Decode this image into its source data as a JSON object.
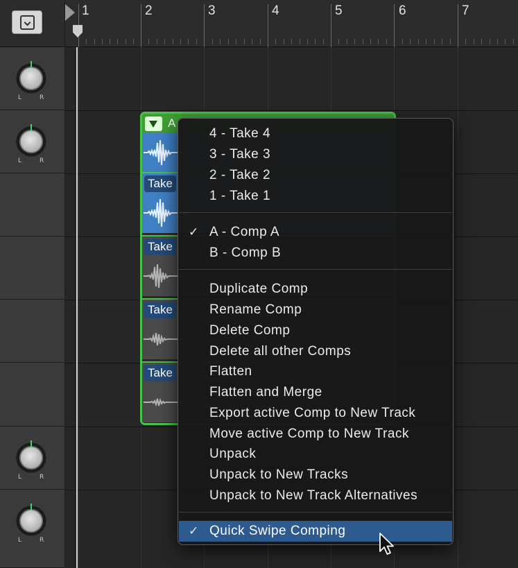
{
  "ruler": {
    "bars": [
      "1",
      "2",
      "3",
      "4",
      "5",
      "6",
      "7"
    ]
  },
  "tracks": {
    "pan_left": "L",
    "pan_right": "R"
  },
  "take_folder": {
    "active_comp_label": "A",
    "takes": [
      {
        "label": "Take",
        "active": true
      },
      {
        "label": "Take",
        "active": false
      },
      {
        "label": "Take",
        "active": false
      },
      {
        "label": "Take",
        "active": false
      }
    ]
  },
  "context_menu": {
    "takes": [
      "4 - Take 4",
      "3 - Take 3",
      "2 - Take 2",
      "1 - Take 1"
    ],
    "comps": [
      {
        "label": "A - Comp A",
        "checked": true
      },
      {
        "label": "B - Comp B",
        "checked": false
      }
    ],
    "actions": [
      "Duplicate Comp",
      "Rename Comp",
      "Delete Comp",
      "Delete all other Comps",
      "Flatten",
      "Flatten and Merge",
      "Export active Comp to New Track",
      "Move active Comp to New Track",
      "Unpack",
      "Unpack to New Tracks",
      "Unpack to New Track Alternatives"
    ],
    "quick_swipe": {
      "label": "Quick Swipe Comping",
      "checked": true
    },
    "check_glyph": "✓"
  },
  "colors": {
    "region_green": "#49c24a",
    "take_label_blue": "#234a78",
    "waveform_blue": "#3f7fc4",
    "menu_highlight": "#2d5b90",
    "pan_marker": "#43d36b"
  },
  "icons": {
    "track_list_button": "chevron-down-in-box-icon",
    "take_folder_disclosure": "triangle-down-icon",
    "cursor": "arrow-pointer-icon"
  }
}
